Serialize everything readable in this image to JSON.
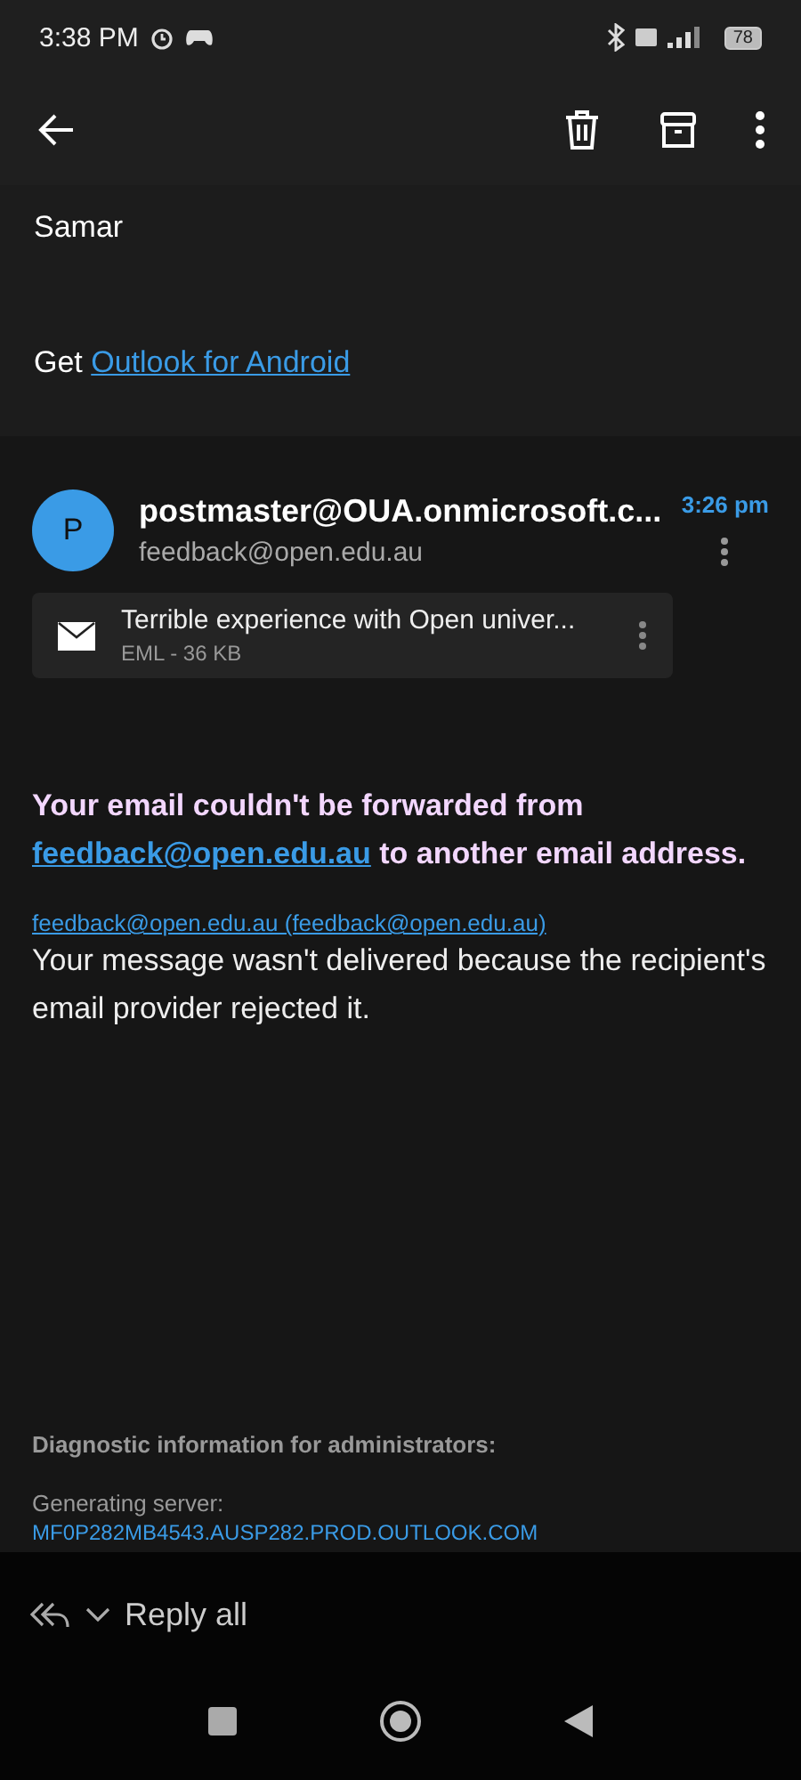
{
  "status_bar": {
    "time": "3:38 PM",
    "battery": "78"
  },
  "previous_message": {
    "sender": "Samar",
    "get_prefix": "Get ",
    "get_link": "Outlook for Android"
  },
  "message": {
    "avatar": "P",
    "from": "postmaster@OUA.onmicrosoft.c...",
    "to": "feedback@open.edu.au",
    "time": "3:26 pm",
    "attachment": {
      "name": "Terrible experience with Open univer...",
      "meta": "EML - 36 KB"
    },
    "heading_before": "Your email couldn't be forwarded from ",
    "heading_link": "feedback@open.edu.au",
    "heading_after": " to another email address.",
    "recipient_link": "feedback@open.edu.au (feedback@open.edu.au)",
    "body": "Your message wasn't delivered because the recipient's email provider rejected it.",
    "diagnostic_title": "Diagnostic information for administrators:",
    "server_label": "Generating server:",
    "server": "MF0P282MB4543.AUSP282.PROD.OUTLOOK.COM"
  },
  "reply_bar": {
    "label": "Reply all"
  }
}
